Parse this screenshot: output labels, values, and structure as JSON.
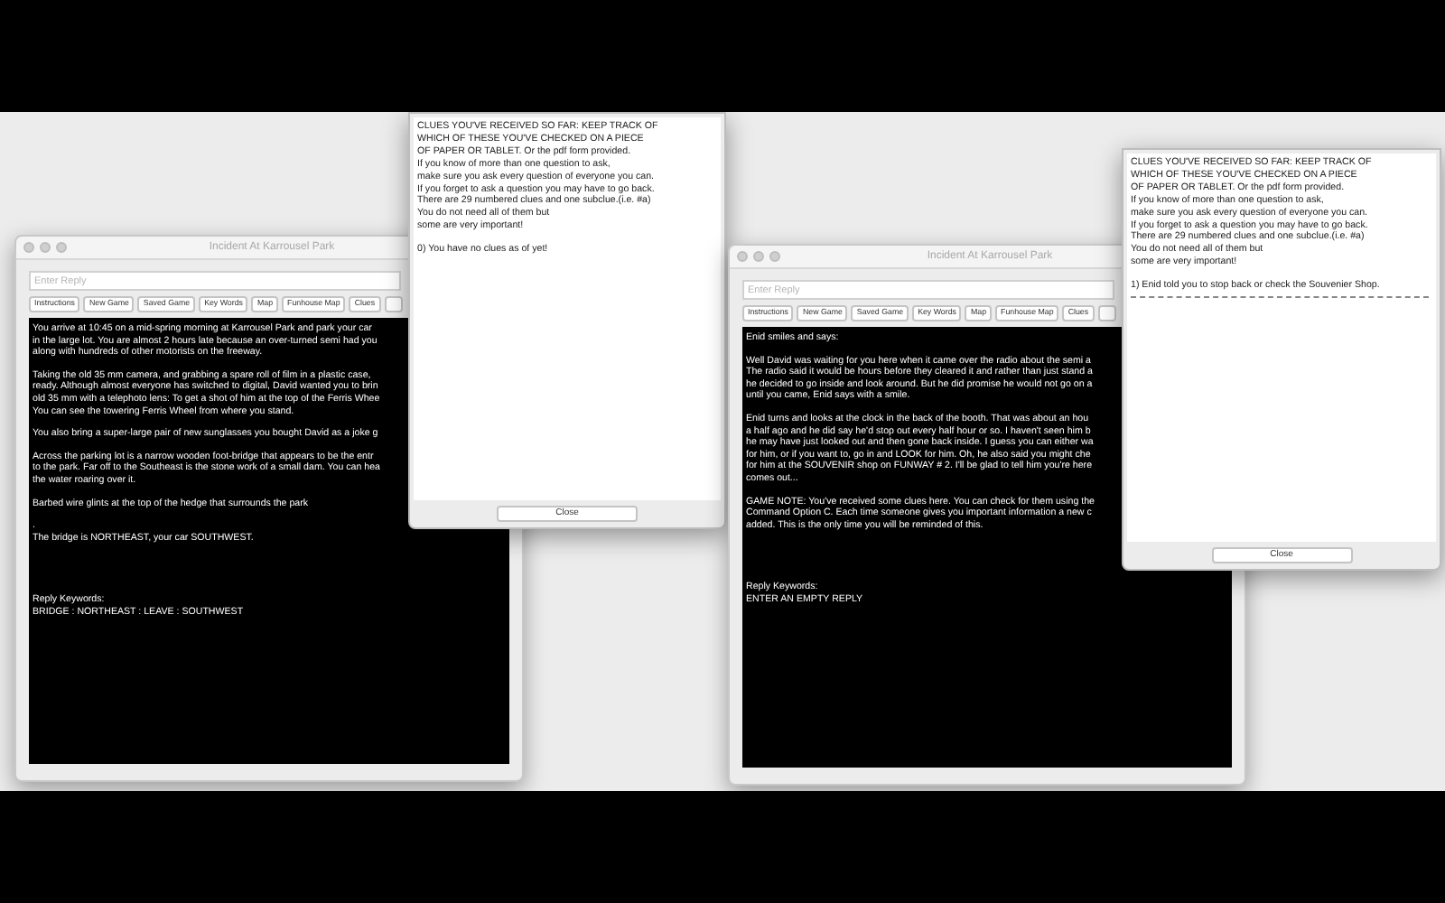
{
  "screens": [
    {
      "window": {
        "title": "Incident At Karrousel Park",
        "reply_field": {
          "placeholder": "Enter Reply"
        },
        "buttons": [
          "Instructions",
          "New Game",
          "Saved Game",
          "Key Words",
          "Map",
          "Funhouse Map",
          "Clues"
        ],
        "story": [
          {
            "kind": "text",
            "lines": [
              "You arrive at 10:45 on a mid-spring morning at Karrousel Park and park your car",
              "in the large lot. You are almost 2 hours late because an over-turned semi had you",
              "along with hundreds of other motorists on the freeway."
            ]
          },
          {
            "kind": "text",
            "lines": [
              "Taking the old 35 mm camera, and grabbing a spare roll of film in a plastic case,",
              "ready. Although almost everyone has switched to digital, David wanted you to brin",
              "old 35 mm with a telephoto lens: To get a shot of him at the top of the Ferris Whee",
              "You can see the towering Ferris Wheel from where you stand."
            ]
          },
          {
            "kind": "text",
            "lines": [
              "You also bring a super-large pair of new sunglasses you bought David as a joke g"
            ]
          },
          {
            "kind": "text",
            "lines": [
              "Across the parking lot is a narrow wooden foot-bridge that appears to be the entr",
              "to the park. Far off to the Southeast is the stone work of a small dam. You can hea",
              "the water roaring over it."
            ]
          },
          {
            "kind": "text",
            "lines": [
              "Barbed wire glints at the top of the hedge that surrounds the park"
            ]
          },
          {
            "kind": "text",
            "lines": [
              ".",
              "The bridge is NORTHEAST, your car SOUTHWEST."
            ]
          },
          {
            "kind": "keywords",
            "lines": [
              "Reply Keywords:",
              "BRIDGE : NORTHEAST : LEAVE : SOUTHWEST"
            ]
          }
        ]
      },
      "clues_popup": {
        "lines": [
          "CLUES YOU'VE RECEIVED SO FAR: KEEP TRACK OF",
          "WHICH OF THESE YOU'VE CHECKED ON A PIECE",
          "OF PAPER OR TABLET. Or the pdf form provided.",
          "If you know of more than one question to ask,",
          "make sure you ask every question of everyone you can.",
          "If you forget to ask a question you may have to go back.",
          "There are 29 numbered clues and one subclue.(i.e. #a)",
          "You do not need all of them but",
          "some are very important!"
        ],
        "clues": [
          {
            "text": "0) You have no clues as of yet!",
            "divider": false
          }
        ],
        "close_button": "Close"
      }
    },
    {
      "window": {
        "title": "Incident At Karrousel Park",
        "reply_field": {
          "placeholder": "Enter Reply"
        },
        "buttons": [
          "Instructions",
          "New Game",
          "Saved Game",
          "Key Words",
          "Map",
          "Funhouse Map",
          "Clues"
        ],
        "story": [
          {
            "kind": "text",
            "lines": [
              "Enid smiles and says:"
            ]
          },
          {
            "kind": "text",
            "lines": [
              "Well David was waiting for you here when it came over the radio about the semi a",
              "The radio said it would be hours before they cleared it and rather than just stand a",
              "he decided to go inside and look around. But he did promise he would not go on a",
              "until you came, Enid says with a smile."
            ]
          },
          {
            "kind": "text",
            "lines": [
              "Enid turns and looks at the clock in the back of the booth. That was about an hou",
              "a half ago and he did say he'd stop out every half hour or so. I haven't seen him b",
              "he may have just looked out and then gone back inside. I guess you can either wa",
              "for him, or if you want to, go in and LOOK for him. Oh, he also said you might che",
              "for him at the SOUVENIR shop on FUNWAY # 2. I'll be glad to tell him you're here",
              "comes out..."
            ]
          },
          {
            "kind": "text",
            "lines": [
              "GAME NOTE: You've received some clues here. You can check for them using the",
              "Command Option C. Each time someone gives you important information a new c",
              "added. This is the only time you will be reminded of this."
            ]
          },
          {
            "kind": "keywords",
            "lines": [
              "Reply Keywords:",
              "ENTER AN EMPTY REPLY"
            ]
          }
        ]
      },
      "clues_popup": {
        "lines": [
          "CLUES YOU'VE RECEIVED SO FAR: KEEP TRACK OF",
          "WHICH OF THESE YOU'VE CHECKED ON A PIECE",
          "OF PAPER OR TABLET. Or the pdf form provided.",
          "If you know of more than one question to ask,",
          "make sure you ask every question of everyone you can.",
          "If you forget to ask a question you may have to go back.",
          "There are 29 numbered clues and one subclue.(i.e. #a)",
          "You do not need all of them but",
          "some are very important!"
        ],
        "clues": [
          {
            "text": "1) Enid told you to stop back or check the Souvenier Shop.",
            "divider": true
          }
        ],
        "close_button": "Close"
      }
    }
  ]
}
